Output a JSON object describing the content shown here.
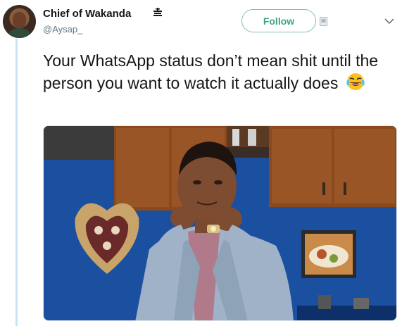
{
  "tweet": {
    "display_name": "Chief of Wakanda",
    "handle": "@Aysap_",
    "text": "Your WhatsApp status don’t mean shit until the person you want to watch it actually does",
    "follow_label": "Follow"
  },
  "icons": {
    "crown": "crown-icon",
    "badge": "badge-icon",
    "chevron": "chevron-down-icon",
    "emoji": "laughing-tears-emoji"
  },
  "colors": {
    "follow_accent": "#3fa383",
    "thread_line": "#c9e3f5"
  }
}
